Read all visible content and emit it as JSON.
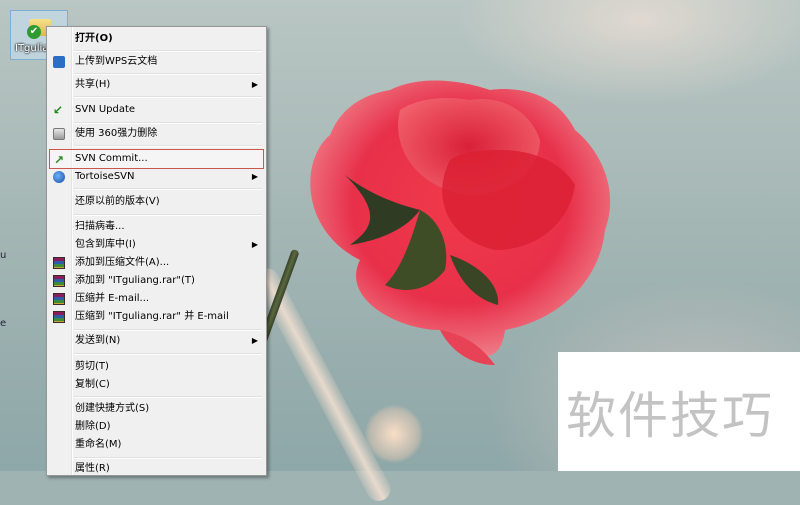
{
  "desktop": {
    "icon_label": "ITguliang",
    "edge_labels": [
      "u",
      "e"
    ]
  },
  "context_menu": {
    "items": [
      {
        "label": "打开(O)",
        "bold": true
      },
      {
        "label": "上传到WPS云文档",
        "icon": "wps-cloud-icon"
      },
      {
        "label": "共享(H)",
        "submenu": true
      },
      {
        "label": "SVN Update",
        "icon": "svn-update-icon"
      },
      {
        "label": "使用 360强力删除",
        "icon": "shredder-360-icon"
      },
      {
        "label": "SVN Commit...",
        "icon": "svn-commit-icon",
        "highlighted": true
      },
      {
        "label": "TortoiseSVN",
        "icon": "tortoisesvn-icon",
        "submenu": true
      },
      {
        "label": "还原以前的版本(V)"
      },
      {
        "label": "扫描病毒..."
      },
      {
        "label": "包含到库中(I)",
        "submenu": true
      },
      {
        "label": "添加到压缩文件(A)...",
        "icon": "winrar-icon"
      },
      {
        "label": "添加到 \"ITguliang.rar\"(T)",
        "icon": "winrar-icon"
      },
      {
        "label": "压缩并 E-mail...",
        "icon": "winrar-icon"
      },
      {
        "label": "压缩到 \"ITguliang.rar\" 并 E-mail",
        "icon": "winrar-icon"
      },
      {
        "label": "发送到(N)",
        "submenu": true
      },
      {
        "label": "剪切(T)"
      },
      {
        "label": "复制(C)"
      },
      {
        "label": "创建快捷方式(S)"
      },
      {
        "label": "删除(D)"
      },
      {
        "label": "重命名(M)"
      },
      {
        "label": "属性(R)"
      }
    ],
    "submenu_arrow": "▶"
  },
  "watermark": {
    "text": "软件技巧"
  },
  "colors": {
    "highlight_border": "#c9574f",
    "menu_background": "#f0f0f0"
  }
}
